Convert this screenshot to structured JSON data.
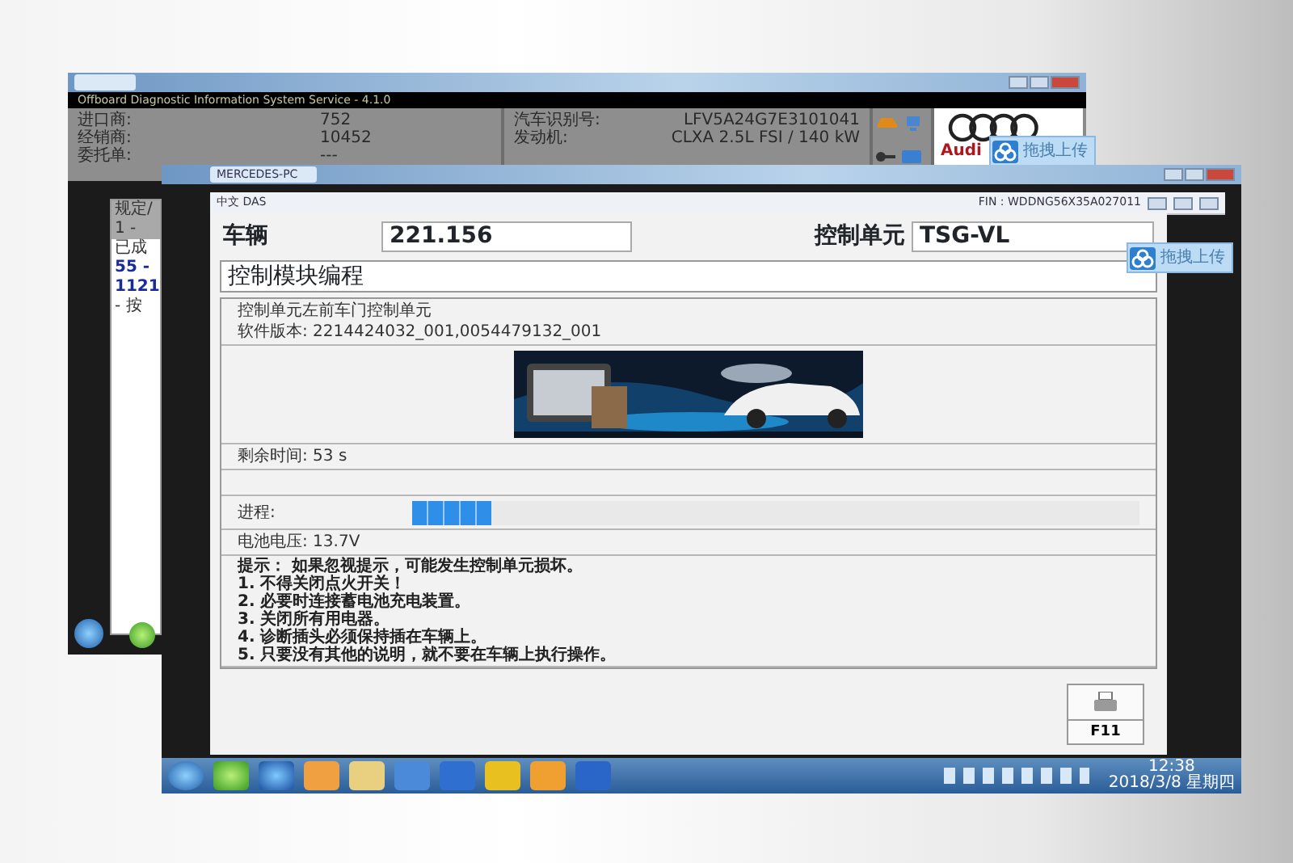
{
  "back_window": {
    "app_title": "Offboard Diagnostic Information System Service - 4.1.0",
    "dealer_info": [
      {
        "label": "进口商:",
        "value": "752"
      },
      {
        "label": "经销商:",
        "value": "10452"
      },
      {
        "label": "委托单:",
        "value": "---"
      }
    ],
    "vehicle_info": [
      {
        "label": "汽车识别号:",
        "value": "LFV5A24G7E3101041"
      },
      {
        "label": "发动机:",
        "value": "CLXA 2.5L FSI / 140 kW"
      }
    ],
    "logo_text": "Audi",
    "upload_badge": "拖拽上传",
    "sidebar_texts": [
      "规定/",
      "1 -",
      "已成",
      "55 -",
      "1121",
      "- 按"
    ]
  },
  "front_window": {
    "tab_title": "MERCEDES-PC",
    "app_title": "中文 DAS",
    "fin": "FIN : WDDNG56X35A027011",
    "upload_badge": "拖拽上传",
    "vehicle_label": "车辆",
    "vehicle_value": "221.156",
    "unit_label": "控制单元",
    "unit_value": "TSG-VL",
    "section_title": "控制模块编程",
    "unit_name": "控制单元左前车门控制单元",
    "software_version": "软件版本: 2214424032_001,0054479132_001",
    "remaining_time": "剩余时间: 53 s",
    "progress_label": "进程:",
    "progress": {
      "level": 0.11
    },
    "battery_voltage": "电池电压: 13.7V",
    "tips": [
      "提示： 如果忽视提示，可能发生控制单元损坏。",
      "1. 不得关闭点火开关！",
      "2. 必要时连接蓄电池充电装置。",
      "3. 关闭所有用电器。",
      "4. 诊断插头必须保持插在车辆上。",
      "5. 只要没有其他的说明，就不要在车辆上执行操作。"
    ],
    "print_button": "F11"
  },
  "taskbar": {
    "time": "12:38",
    "date": "2018/3/8 星期四"
  }
}
